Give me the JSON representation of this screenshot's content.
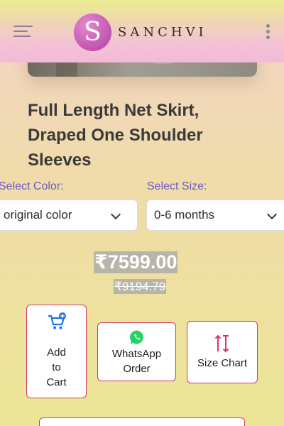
{
  "header": {
    "logo_letter": "S",
    "brand_name": "SANCHVI"
  },
  "product": {
    "title": "Full Length Net Skirt, Draped One Shoulder Sleeves",
    "price": "₹7599.00",
    "original_price": "₹9194.79"
  },
  "options": {
    "color_label": "Select Color:",
    "color_value": "original color",
    "size_label": "Select Size:",
    "size_value": "0-6 months"
  },
  "actions": {
    "add_to_cart": "Add to Cart",
    "whatsapp_order": "WhatsApp Order",
    "size_chart": "Size Chart"
  },
  "colors": {
    "accent_border": "#d6376a",
    "label_purple": "#6b5bc9",
    "logo_pink": "#c85cb3",
    "cart_blue": "#1a73e8",
    "whatsapp_green": "#25d366",
    "size_chart_red": "#d6376a"
  },
  "icons": {
    "menu": "hamburger-menu-icon",
    "more": "kebab-menu-icon",
    "cart": "cart-plus-icon",
    "whatsapp": "whatsapp-icon",
    "size_chart": "size-arrows-icon"
  }
}
